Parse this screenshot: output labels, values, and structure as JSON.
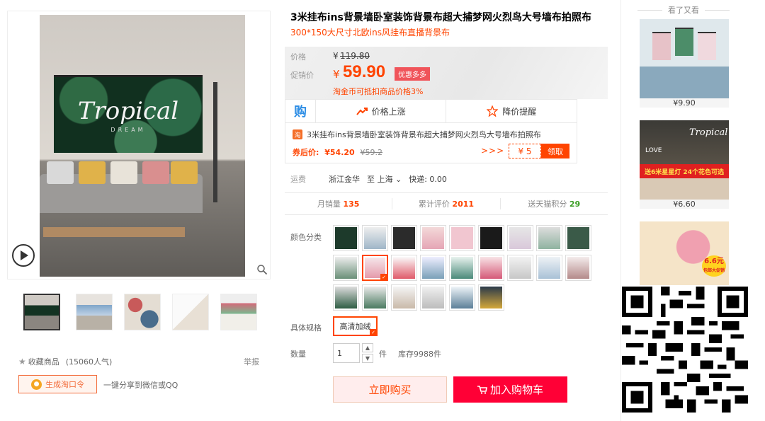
{
  "product": {
    "title": "3米挂布ins背景墙卧室装饰背景布超大捕梦网火烈鸟大号墙布拍照布",
    "subtitle": "300*150大尺寸北欧ins风挂布直播背景布",
    "image_title": "Tropical",
    "image_subtitle": "DREAM"
  },
  "price": {
    "label": "价格",
    "yen": "¥",
    "original": "119.80",
    "promo_label": "促销价",
    "promo": "59.90",
    "promo_tag": "优惠多多",
    "coin_note": "淘金币可抵扣商品价格3%"
  },
  "gou": {
    "logo": "购",
    "rise": "价格上涨",
    "alert": "降价提醒",
    "coupon_item": "3米挂布ins背景墙卧室装饰背景布超大捕梦网火烈鸟大号墙布拍照布",
    "tm_badge": "淘",
    "after_coupon_label": "券后价:",
    "after_coupon_price": "¥54.20",
    "after_coupon_orig": "¥59.2",
    "arrows": ">>>",
    "coupon_value": "¥ 5",
    "claim": "领取"
  },
  "shipping": {
    "label": "运费",
    "from": "浙江金华",
    "to": "至 上海",
    "express": "快递: 0.00"
  },
  "stats": {
    "monthly_label": "月销量",
    "monthly": "135",
    "reviews_label": "累计评价",
    "reviews": "2011",
    "points_label": "送天猫积分",
    "points": "29"
  },
  "options": {
    "color_label": "颜色分类",
    "spec_label": "具体规格",
    "spec_value": "高清加绒",
    "qty_label": "数量",
    "qty": "1",
    "qty_unit": "件",
    "stock": "库存9988件"
  },
  "actions": {
    "buy": "立即购买",
    "cart": "加入购物车"
  },
  "left": {
    "collect": "收藏商品",
    "popularity": "(15060人气)",
    "report": "举报",
    "token_btn": "生成淘口令",
    "share": "一键分享到微信或QQ"
  },
  "recommend": {
    "title": "看了又看",
    "items": [
      {
        "price": "¥9.90"
      },
      {
        "price": "¥6.60",
        "banner": "送6米星星灯 24个花色可选",
        "brand": "Tropical",
        "love": "LOVE"
      },
      {
        "badge": "6.6元",
        "badge_sub": "包邮大促销"
      }
    ]
  },
  "colors": {
    "accent": "#ff4400",
    "cart": "#ff0036",
    "link_blue": "#2e8ee5"
  }
}
